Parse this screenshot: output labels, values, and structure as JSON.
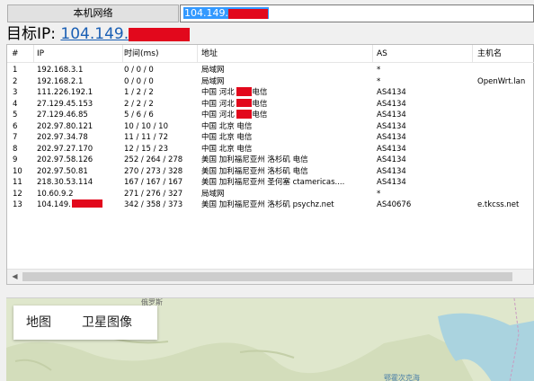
{
  "toolbar": {
    "network_button": "本机网络",
    "address_value": "104.149."
  },
  "target": {
    "label": "目标IP: ",
    "ip": "104.149."
  },
  "table": {
    "headers": [
      "#",
      "IP",
      "时间(ms)",
      "地址",
      "AS",
      "主机名"
    ],
    "rows": [
      {
        "idx": "1",
        "ip": "192.168.3.1",
        "time": "0 / 0 / 0",
        "addr": "局域网",
        "as": "*",
        "host": ""
      },
      {
        "idx": "2",
        "ip": "192.168.2.1",
        "time": "0 / 0 / 0",
        "addr": "局域网",
        "as": "*",
        "host": "OpenWrt.lan"
      },
      {
        "idx": "3",
        "ip": "111.226.192.1",
        "time": "1 / 2 / 2",
        "addr": "中国 河北 ",
        "addr_suffix": "电信",
        "as": "AS4134",
        "host": "",
        "redact": true
      },
      {
        "idx": "4",
        "ip": "27.129.45.153",
        "time": "2 / 2 / 2",
        "addr": "中国 河北 ",
        "addr_suffix": "电信",
        "as": "AS4134",
        "host": "",
        "redact": true
      },
      {
        "idx": "5",
        "ip": "27.129.46.85",
        "time": "5 / 6 / 6",
        "addr": "中国 河北 ",
        "addr_suffix": "电信",
        "as": "AS4134",
        "host": "",
        "redact": true
      },
      {
        "idx": "6",
        "ip": "202.97.80.121",
        "time": "10 / 10 / 10",
        "addr": "中国 北京 电信",
        "as": "AS4134",
        "host": ""
      },
      {
        "idx": "7",
        "ip": "202.97.34.78",
        "time": "11 / 11 / 72",
        "addr": "中国 北京 电信",
        "as": "AS4134",
        "host": ""
      },
      {
        "idx": "8",
        "ip": "202.97.27.170",
        "time": "12 / 15 / 23",
        "addr": "中国 北京 电信",
        "as": "AS4134",
        "host": ""
      },
      {
        "idx": "9",
        "ip": "202.97.58.126",
        "time": "252 / 264 / 278",
        "addr": "美国 加利福尼亚州 洛杉矶 电信",
        "as": "AS4134",
        "host": ""
      },
      {
        "idx": "10",
        "ip": "202.97.50.81",
        "time": "270 / 273 / 328",
        "addr": "美国 加利福尼亚州 洛杉矶 电信",
        "as": "AS4134",
        "host": ""
      },
      {
        "idx": "11",
        "ip": "218.30.53.114",
        "time": "167 / 167 / 167",
        "addr": "美国 加利福尼亚州 圣何塞 ctamericas....",
        "as": "AS4134",
        "host": ""
      },
      {
        "idx": "12",
        "ip": "10.60.9.2",
        "time": "271 / 276 / 327",
        "addr": "局域网",
        "as": "*",
        "host": ""
      },
      {
        "idx": "13",
        "ip": "104.149.",
        "time": "342 / 358 / 373",
        "addr": "美国 加利福尼亚州 洛杉矶 psychz.net",
        "as": "AS40676",
        "host": "e.tkcss.net",
        "ip_redact": true
      }
    ]
  },
  "map": {
    "tab_map": "地图",
    "tab_satellite": "卫星图像",
    "label_top": "俄罗斯",
    "label_right": "鄂霍次克海"
  }
}
